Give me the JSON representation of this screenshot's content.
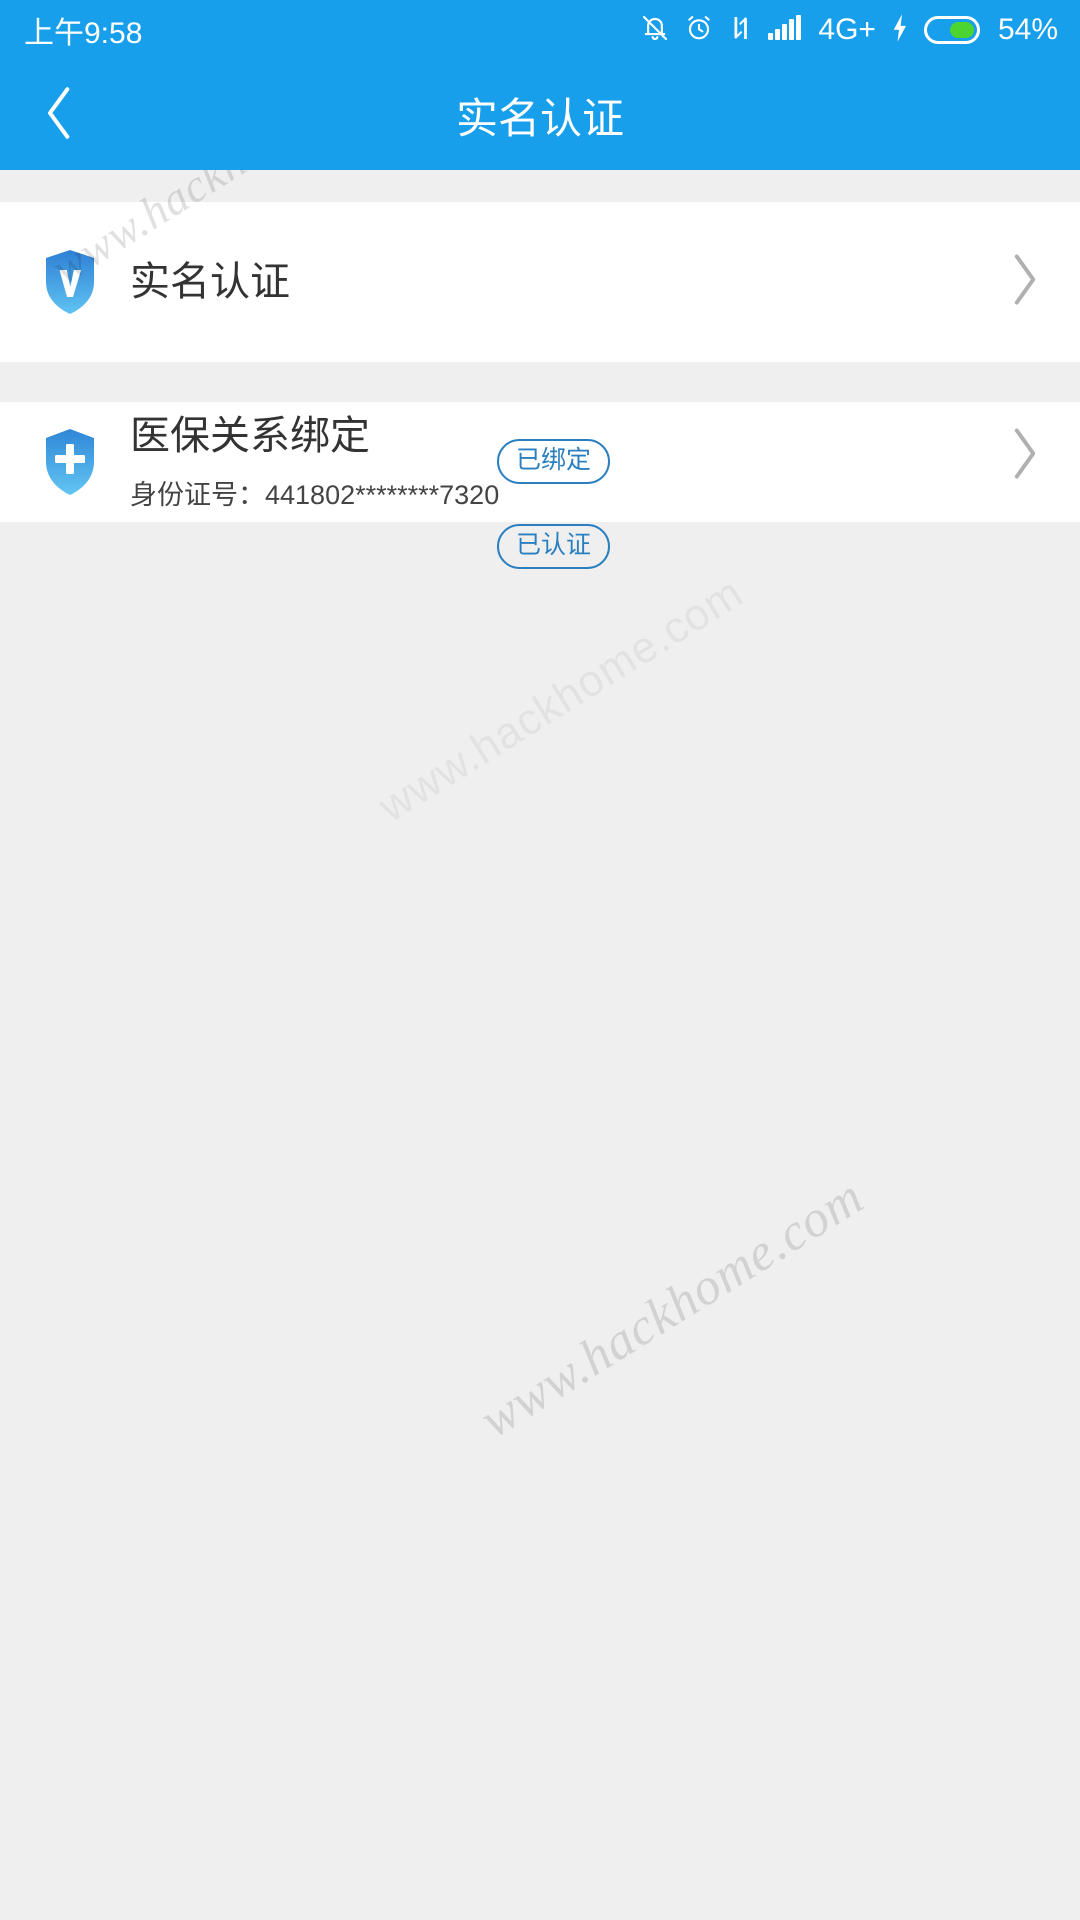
{
  "status_bar": {
    "time": "上午9:58",
    "network_label": "4G+",
    "battery_percent": "54%",
    "battery_level": 54,
    "icons": [
      "bell-muted-icon",
      "alarm-clock-icon",
      "data-transfer-icon",
      "signal-bars-icon",
      "charging-bolt-icon",
      "battery-icon"
    ],
    "background_color": "#189fec",
    "battery_fill_color": "#4cd430"
  },
  "header": {
    "title": "实名认证",
    "back_icon": "chevron-left-icon",
    "background_color": "#189fec"
  },
  "list": {
    "items": [
      {
        "icon": "shield-verified-icon",
        "icon_glyph": "V",
        "title": "实名认证",
        "badge": "已认证",
        "subtitle": "",
        "chevron": "chevron-right-icon"
      },
      {
        "icon": "shield-medical-icon",
        "icon_glyph": "+",
        "title": "医保关系绑定",
        "badge": "已绑定",
        "subtitle": "身份证号：441802********7320",
        "chevron": "chevron-right-icon"
      }
    ],
    "badge_color": "#2a7fc0",
    "row_background": "#ffffff",
    "page_background": "#efefef"
  },
  "watermark": {
    "text": "www.hackhome.com"
  }
}
